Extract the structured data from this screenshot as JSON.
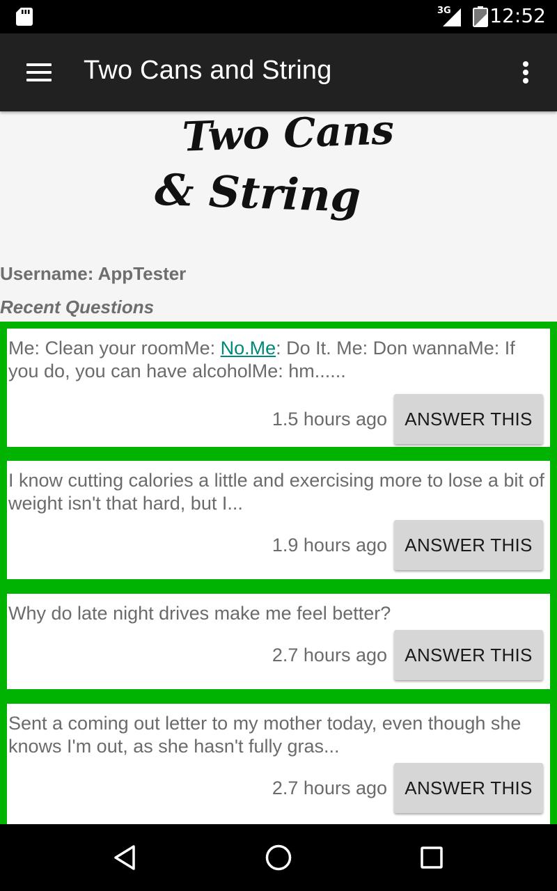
{
  "status_bar": {
    "network": "3G",
    "time": "12:52",
    "icons": [
      "sd-card-icon",
      "signal-icon",
      "battery-icon"
    ]
  },
  "app_bar": {
    "title": "Two Cans and String",
    "icons": [
      "menu-icon",
      "overflow-icon"
    ]
  },
  "logo": {
    "line1": "Two Cans",
    "line2": "& String"
  },
  "profile": {
    "username": "Username: AppTester"
  },
  "questions": {
    "title": "Recent Questions",
    "items": [
      {
        "text_before": "Me: Clean your roomMe: ",
        "link": "No.Me",
        "text_after": ": Do It. Me: Don wannaMe: If you do, you can have alcoholMe: hm......",
        "time": "1.5 hours ago",
        "button": "ANSWER THIS"
      },
      {
        "text_before": "I know cutting calories a little and exercising more to lose a bit of weight isn't that hard, but I...",
        "link": "",
        "text_after": "",
        "time": "1.9 hours ago",
        "button": "ANSWER THIS"
      },
      {
        "text_before": "Why do late night drives make me feel better?",
        "link": "",
        "text_after": "",
        "time": "2.7 hours ago",
        "button": "ANSWER THIS"
      },
      {
        "text_before": "Sent a coming out letter to my mother today, even though she knows I'm out, as she hasn't fully gras...",
        "link": "",
        "text_after": "",
        "time": "2.7 hours ago",
        "button": "ANSWER THIS"
      }
    ]
  },
  "colors": {
    "app_bar": "#212121",
    "list_background": "#00b300",
    "link": "#00897b",
    "button": "#d6d6d6"
  },
  "nav_bar": {
    "icons": [
      "back-icon",
      "home-icon",
      "recents-icon"
    ]
  }
}
